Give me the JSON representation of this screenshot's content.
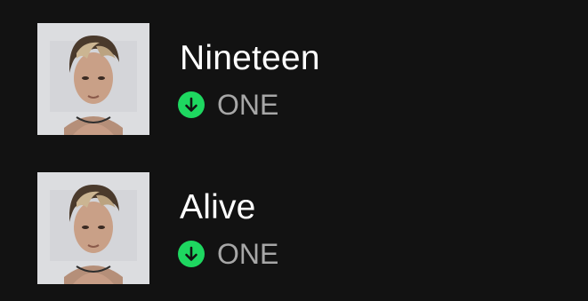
{
  "tracks": [
    {
      "title": "Nineteen",
      "artist": "ONE",
      "downloaded": true,
      "cover_icon": "album-art"
    },
    {
      "title": "Alive",
      "artist": "ONE",
      "downloaded": true,
      "cover_icon": "album-art"
    }
  ],
  "colors": {
    "background": "#121212",
    "title": "#ffffff",
    "subtitle": "#a7a7a7",
    "download_badge": "#1ed760"
  },
  "icons": {
    "download": "download-arrow-icon"
  }
}
